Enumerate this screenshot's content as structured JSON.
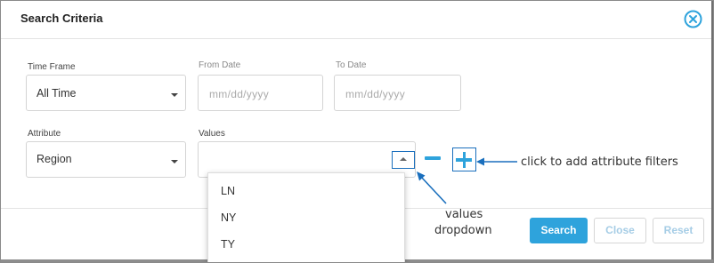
{
  "dialog": {
    "title": "Search Criteria"
  },
  "time_frame": {
    "label": "Time Frame",
    "value": "All Time"
  },
  "from_date": {
    "label": "From Date",
    "placeholder": "mm/dd/yyyy"
  },
  "to_date": {
    "label": "To Date",
    "placeholder": "mm/dd/yyyy"
  },
  "attribute": {
    "label": "Attribute",
    "value": "Region"
  },
  "values": {
    "label": "Values",
    "options": [
      "LN",
      "NY",
      "TY"
    ]
  },
  "buttons": {
    "search": "Search",
    "close": "Close",
    "reset": "Reset"
  },
  "annotations": {
    "add_filters": "click to add attribute filters",
    "values_dropdown_line1": "values",
    "values_dropdown_line2": "dropdown"
  },
  "colors": {
    "accent": "#2ea3dc",
    "annotation": "#1a6fbd"
  },
  "icons": {
    "close": "close-circle-icon",
    "remove_filter": "minus-icon",
    "add_filter": "plus-icon",
    "dropdown_toggle": "caret-up-icon"
  }
}
